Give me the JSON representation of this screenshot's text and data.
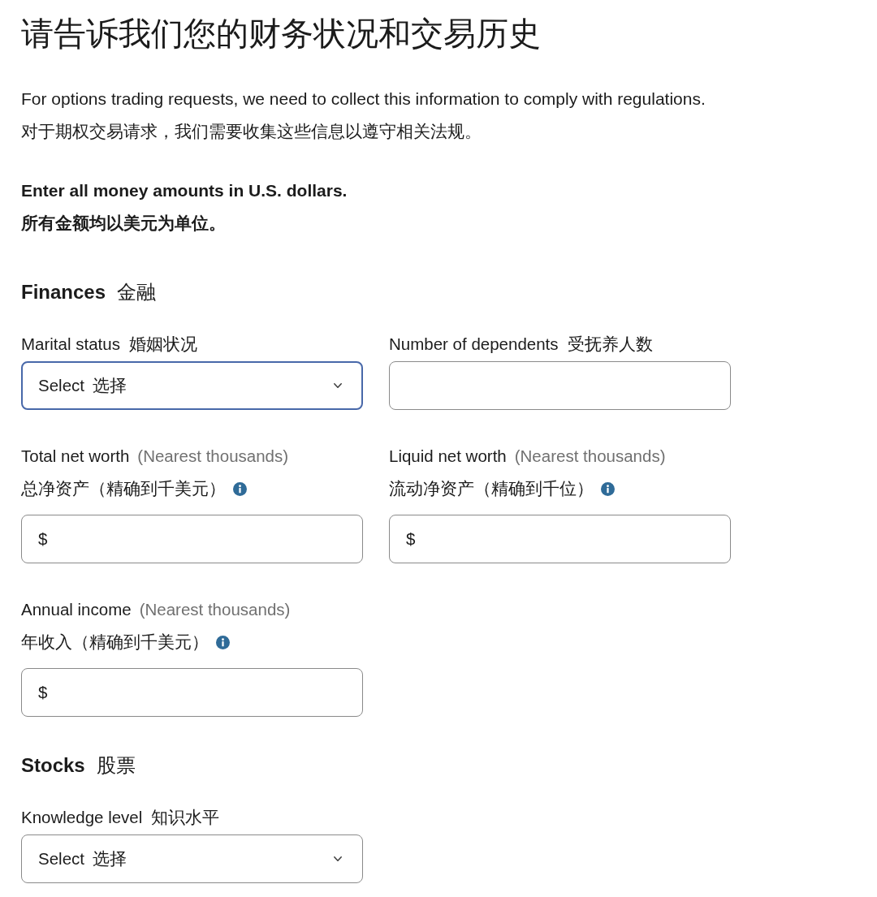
{
  "header": {
    "title": "请告诉我们您的财务状况和交易历史"
  },
  "intro": {
    "lines": [
      "For options trading requests, we need to collect this information to comply with regulations.",
      "对于期权交易请求，我们需要收集这些信息以遵守相关法规。"
    ]
  },
  "notice": {
    "lines": [
      "Enter all money amounts in U.S. dollars.",
      "所有金额均以美元为单位。"
    ]
  },
  "sections": [
    {
      "title": "Finances",
      "title_zh": "金融",
      "fields": [
        {
          "kind": "select",
          "label": "Marital status",
          "label_zh": "婚姻状况",
          "value": "Select",
          "value_zh": "选择",
          "focused": true,
          "info": false
        },
        {
          "kind": "number",
          "label": "Number of dependents",
          "label_zh": "受抚养人数",
          "focused": false,
          "info": false
        },
        {
          "kind": "currency",
          "label": "Total net worth",
          "hint": "(Nearest thousands)",
          "label_zh": "总净资产（精确到千美元）",
          "prefix": "$",
          "focused": false,
          "info": true
        },
        {
          "kind": "currency",
          "label": "Liquid net worth",
          "hint": "(Nearest thousands)",
          "label_zh": "流动净资产（精确到千位）",
          "prefix": "$",
          "focused": false,
          "info": true
        },
        {
          "kind": "currency",
          "label": "Annual income",
          "hint": "(Nearest thousands)",
          "label_zh": "年收入（精确到千美元）",
          "prefix": "$",
          "focused": false,
          "info": true
        }
      ]
    },
    {
      "title": "Stocks",
      "title_zh": "股票",
      "fields": [
        {
          "kind": "select",
          "label": "Knowledge level",
          "label_zh": "知识水平",
          "value": "Select",
          "value_zh": "选择",
          "focused": false,
          "info": false
        }
      ]
    }
  ]
}
